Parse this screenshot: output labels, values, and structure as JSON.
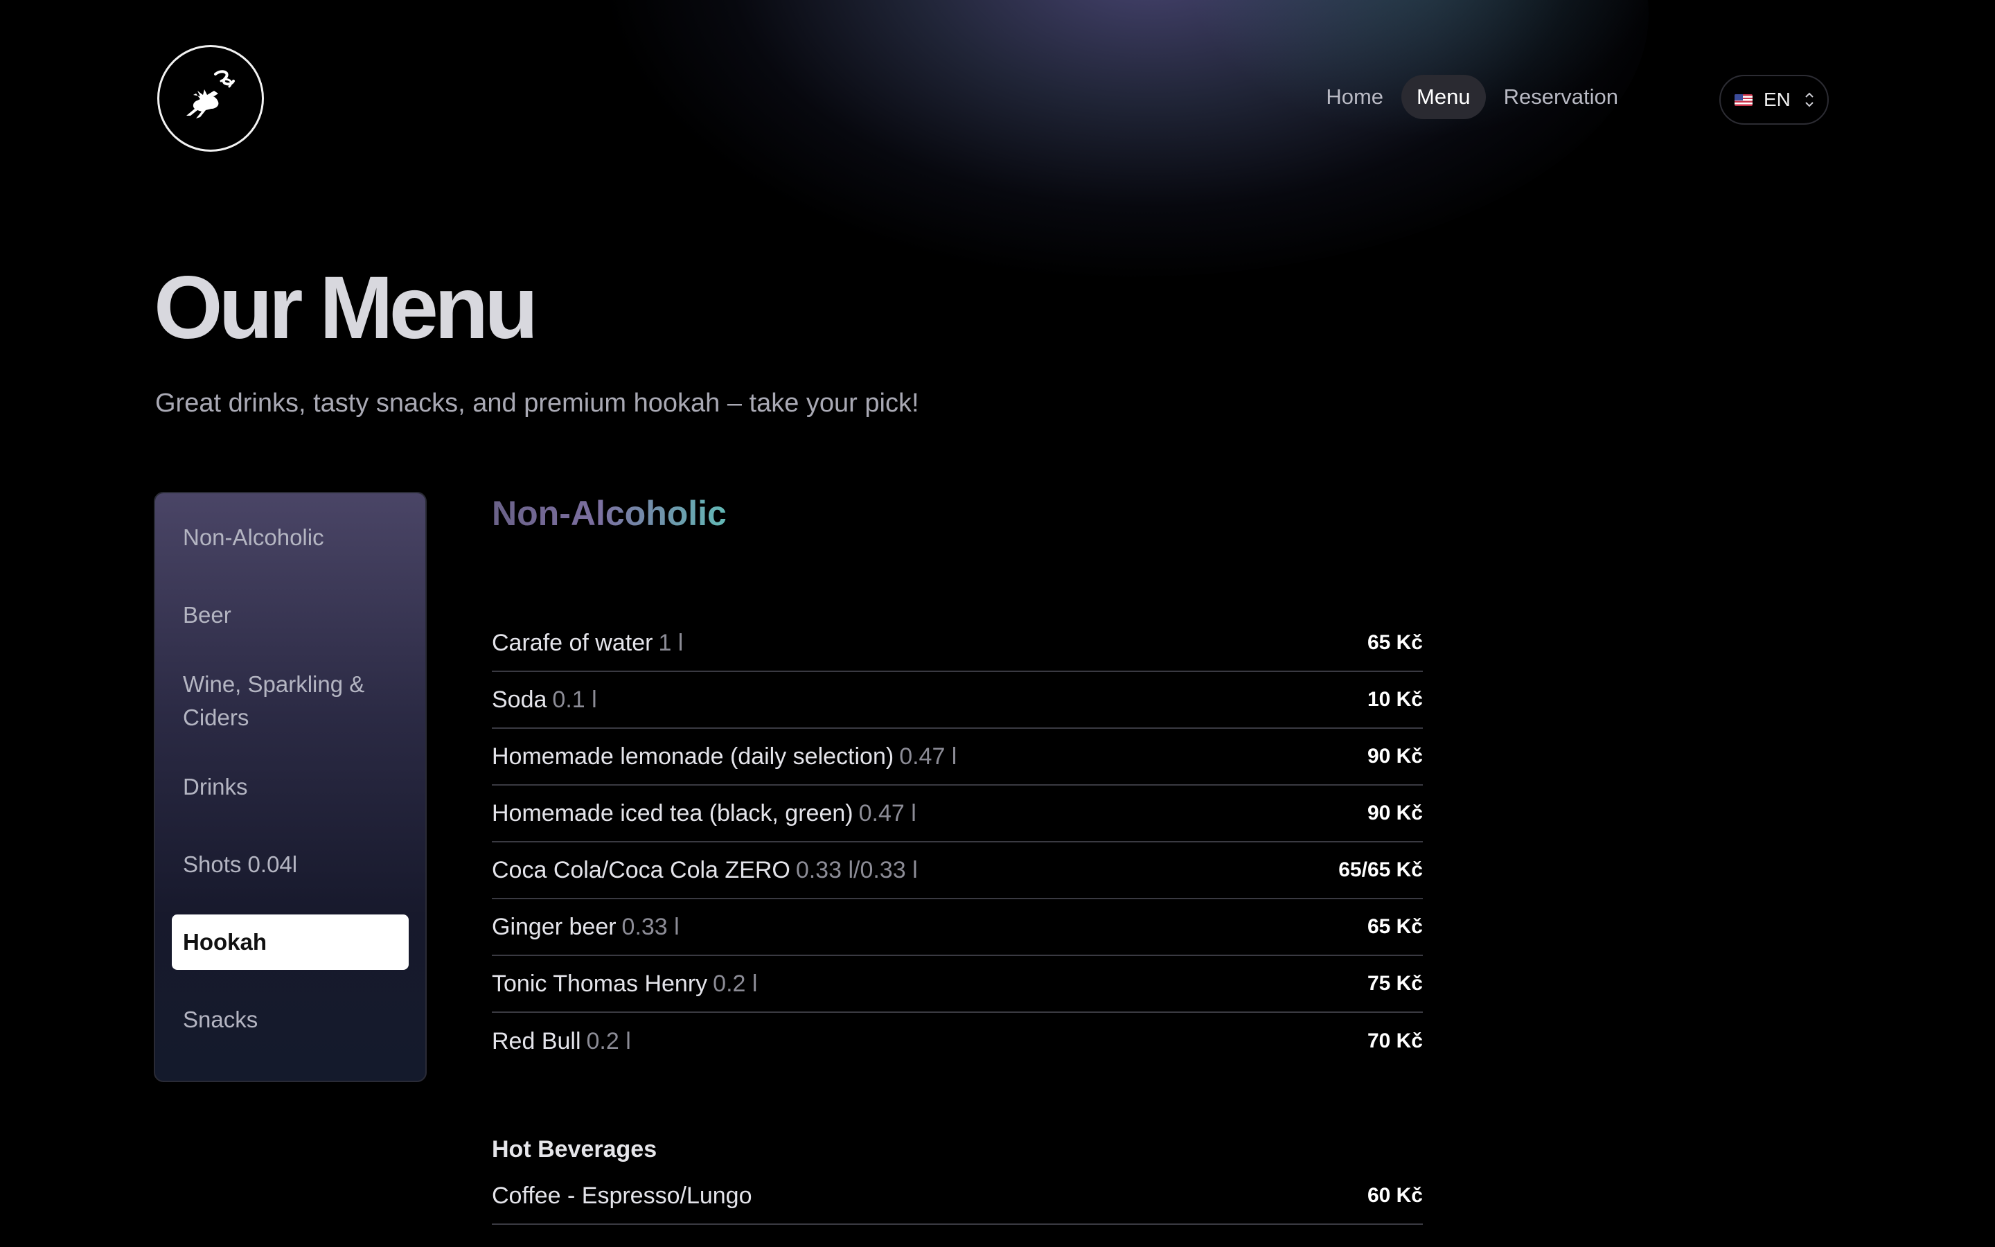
{
  "header": {
    "logo_alt": "deer smoke logo",
    "nav": [
      {
        "label": "Home",
        "active": false
      },
      {
        "label": "Menu",
        "active": true
      },
      {
        "label": "Reservation",
        "active": false
      }
    ],
    "language": {
      "flag_icon": "us-flag-icon",
      "label": "EN"
    }
  },
  "hero": {
    "title": "Our Menu",
    "subtitle": "Great drinks, tasty snacks, and premium hookah – take your pick!"
  },
  "sidebar": {
    "items": [
      {
        "label": "Non-Alcoholic",
        "active": false
      },
      {
        "label": "Beer",
        "active": false
      },
      {
        "label": "Wine, Sparkling & Ciders",
        "active": false
      },
      {
        "label": "Drinks",
        "active": false
      },
      {
        "label": "Shots 0.04l",
        "active": false
      },
      {
        "label": "Hookah",
        "active": true
      },
      {
        "label": "Snacks",
        "active": false
      }
    ]
  },
  "section": {
    "title": "Non-Alcoholic",
    "items": [
      {
        "name": "Carafe of water",
        "size": "1 l",
        "price": "65 Kč"
      },
      {
        "name": "Soda",
        "size": "0.1 l",
        "price": "10 Kč"
      },
      {
        "name": "Homemade lemonade (daily selection)",
        "size": "0.47 l",
        "price": "90 Kč"
      },
      {
        "name": "Homemade iced tea (black, green)",
        "size": "0.47 l",
        "price": "90 Kč"
      },
      {
        "name": "Coca Cola/Coca Cola ZERO",
        "size": "0.33 l/0.33 l",
        "price": "65/65 Kč"
      },
      {
        "name": "Ginger beer",
        "size": "0.33 l",
        "price": "65 Kč"
      },
      {
        "name": "Tonic Thomas Henry",
        "size": "0.2 l",
        "price": "75 Kč"
      },
      {
        "name": "Red Bull",
        "size": "0.2 l",
        "price": "70 Kč"
      }
    ],
    "subsection": {
      "title": "Hot Beverages",
      "items": [
        {
          "name": "Coffee - Espresso/Lungo",
          "size": "",
          "price": "60 Kč"
        }
      ]
    }
  },
  "colors": {
    "background": "#000000",
    "accent_gradient_start": "#6a6288",
    "accent_gradient_end": "#63b9b6"
  }
}
